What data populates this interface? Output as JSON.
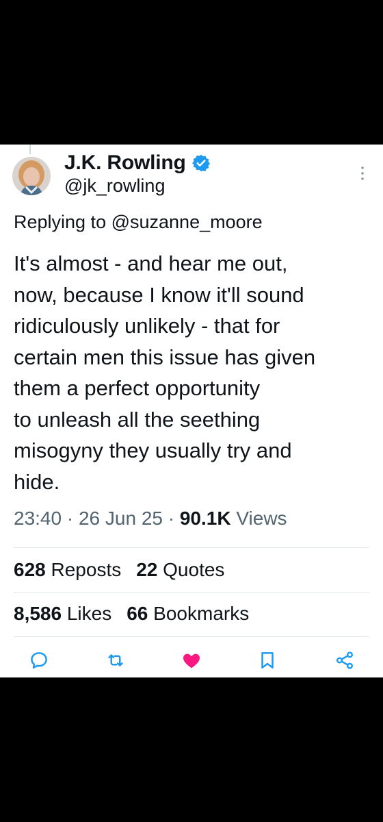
{
  "tweet": {
    "author": {
      "display_name": "J.K. Rowling",
      "handle": "@jk_rowling",
      "verified": true,
      "verified_color": "#1d9bf0"
    },
    "reply_prefix": "Replying to ",
    "reply_to": "@suzanne_moore",
    "body_lines": [
      "It's almost - and hear me out,",
      "now, because I know it'll sound",
      "ridiculously unlikely - that for",
      "certain men this issue has given",
      "them a perfect opportunity",
      "to unleash all the seething",
      "misogyny they usually try and",
      "hide."
    ],
    "time": "23:40",
    "date": "26 Jun 25",
    "separator": "·",
    "views_count": "90.1K",
    "views_label": "Views",
    "stats": {
      "reposts_count": "628",
      "reposts_label": "Reposts",
      "quotes_count": "22",
      "quotes_label": "Quotes",
      "likes_count": "8,586",
      "likes_label": "Likes",
      "bookmarks_count": "66",
      "bookmarks_label": "Bookmarks"
    },
    "actions": [
      {
        "icon": "reply-icon"
      },
      {
        "icon": "repost-icon"
      },
      {
        "icon": "like-icon",
        "active": true,
        "color": "#f91880"
      },
      {
        "icon": "bookmark-icon"
      },
      {
        "icon": "share-icon"
      }
    ],
    "icon_color": "#1d9bf0"
  }
}
